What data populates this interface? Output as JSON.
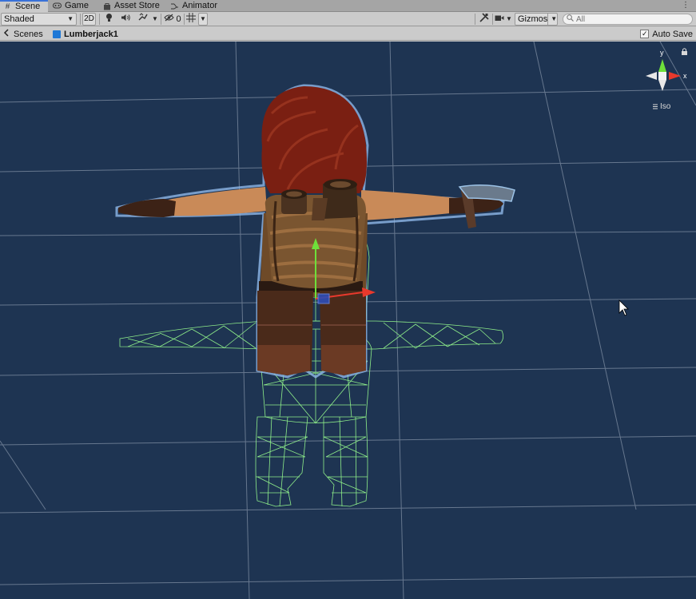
{
  "tabs": [
    {
      "label": "Scene",
      "icon": "hash-grid-icon"
    },
    {
      "label": "Game",
      "icon": "gamepad-icon"
    },
    {
      "label": "Asset Store",
      "icon": "bag-icon"
    },
    {
      "label": "Animator",
      "icon": "animator-icon"
    }
  ],
  "toolbar": {
    "shading_mode": "Shaded",
    "mode_2d": "2D",
    "hidden_count": "0",
    "gizmos_label": "Gizmos",
    "search_placeholder": "All"
  },
  "breadcrumb": {
    "root": "Scenes",
    "current": "Lumberjack1"
  },
  "autosave": {
    "label": "Auto Save",
    "checked": true
  },
  "gizmo": {
    "y_label": "y",
    "x_label": "x",
    "projection_label": "Iso"
  },
  "colors": {
    "viewport_bg": "#1e3452",
    "wireframe": "#8fef8a",
    "axis_x": "#e8392c",
    "axis_y": "#6ee03a",
    "tab_accent": "#3a72d8"
  }
}
